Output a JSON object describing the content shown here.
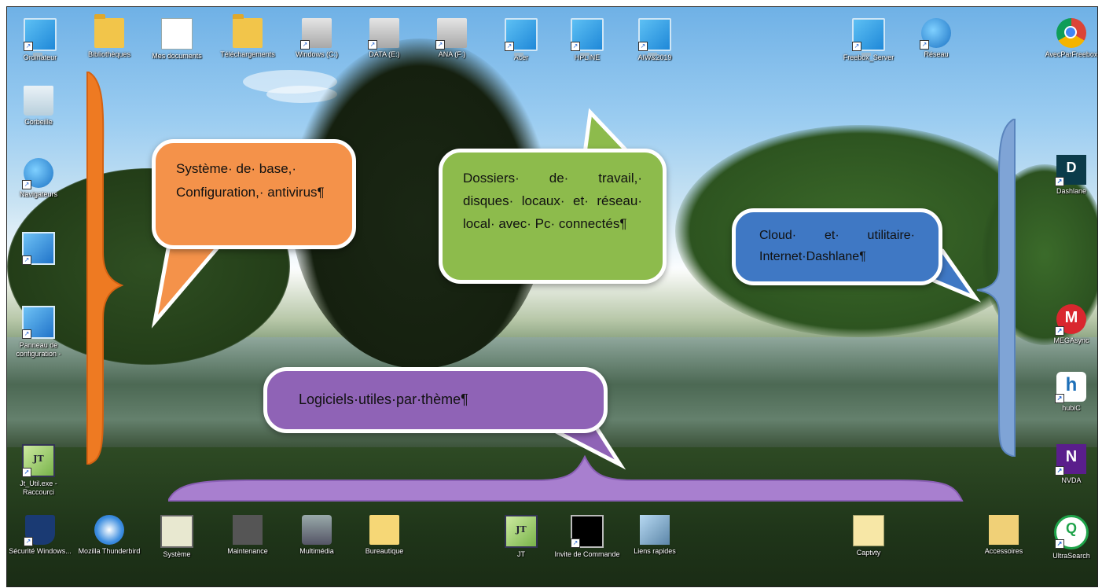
{
  "desktop": {
    "top_icons": [
      {
        "label": "Ordinateur",
        "icon": "monitor-icon",
        "shortcut": true
      },
      {
        "label": "Bibliothèques",
        "icon": "folder-icon",
        "shortcut": false
      },
      {
        "label": "Mes documents",
        "icon": "document-icon",
        "shortcut": false
      },
      {
        "label": "Téléchargements",
        "icon": "download-folder-icon",
        "shortcut": false
      },
      {
        "label": "Windows (C:)",
        "icon": "drive-icon",
        "shortcut": true
      },
      {
        "label": "DATA (E:)",
        "icon": "drive-icon",
        "shortcut": true
      },
      {
        "label": "ANA (F:)",
        "icon": "drive-icon",
        "shortcut": true
      },
      {
        "label": "Acer",
        "icon": "monitor-icon",
        "shortcut": true
      },
      {
        "label": "HPLINE",
        "icon": "monitor-icon",
        "shortcut": true
      },
      {
        "label": "AIW&2019",
        "icon": "monitor-icon",
        "shortcut": true
      },
      {
        "label": "Freebox_Server",
        "icon": "monitor-icon",
        "shortcut": true
      },
      {
        "label": "Réseau",
        "icon": "globe-icon",
        "shortcut": true
      },
      {
        "label": "AvecParFreebox",
        "icon": "chrome-icon",
        "shortcut": false
      }
    ],
    "left_icons": [
      {
        "label": "Corbeille",
        "icon": "recycle-bin-icon",
        "shortcut": false
      },
      {
        "label": "Navigateurs",
        "icon": "globe-icon",
        "shortcut": true
      },
      {
        "label": "",
        "icon": "control-panel-icon",
        "shortcut": true
      },
      {
        "label": "Panneau de configuration -",
        "icon": "control-panel-icon",
        "shortcut": true
      },
      {
        "label": "Jt_Util.exe - Raccourci",
        "icon": "jt-util-icon",
        "shortcut": true
      }
    ],
    "right_icons": [
      {
        "label": "Dashlane",
        "icon": "dashlane-icon",
        "shortcut": true
      },
      {
        "label": "MEGAsync",
        "icon": "mega-icon",
        "shortcut": true
      },
      {
        "label": "hubiC",
        "icon": "hubic-icon",
        "shortcut": true
      },
      {
        "label": "NVDA",
        "icon": "nvda-icon",
        "shortcut": true
      }
    ],
    "bottom_icons": [
      {
        "label": "Sécurité Windows...",
        "icon": "shield-icon",
        "shortcut": true
      },
      {
        "label": "Mozilla Thunderbird",
        "icon": "thunderbird-icon",
        "shortcut": false
      },
      {
        "label": "Système",
        "icon": "computer-icon",
        "shortcut": false
      },
      {
        "label": "Maintenance",
        "icon": "chip-icon",
        "shortcut": false
      },
      {
        "label": "Multimédia",
        "icon": "camera-icon",
        "shortcut": false
      },
      {
        "label": "Bureautique",
        "icon": "office-folder-icon",
        "shortcut": false
      },
      {
        "label": "JT",
        "icon": "jt-icon",
        "shortcut": false
      },
      {
        "label": "Invite de Commande",
        "icon": "command-prompt-icon",
        "shortcut": true
      },
      {
        "label": "Liens rapides",
        "icon": "quick-links-icon",
        "shortcut": false
      },
      {
        "label": "Captvty",
        "icon": "captvty-icon",
        "shortcut": false
      },
      {
        "label": "Accessoires",
        "icon": "accessories-icon",
        "shortcut": false
      },
      {
        "label": "UltraSearch",
        "icon": "search-icon",
        "shortcut": true
      }
    ]
  },
  "callouts": {
    "base": {
      "text": "Système· de· base,· Configuration,· antivirus¶",
      "color": "#f4924a"
    },
    "work": {
      "text": "Dossiers· de· travail,· disques· locaux· et· réseau· local· avec· Pc· connectés¶",
      "color": "#8dbb4c"
    },
    "cloud": {
      "text": "Cloud· et· utilitaire· Internet·Dashlane¶",
      "color": "#3f78c4"
    },
    "software": {
      "text": "Logiciels·utiles·par·thème¶",
      "color": "#8f63b6"
    }
  },
  "braces": {
    "left": {
      "color": "#ee7a22"
    },
    "right": {
      "color": "#7fa4d6"
    },
    "bottom": {
      "color": "#a87fcf"
    }
  }
}
